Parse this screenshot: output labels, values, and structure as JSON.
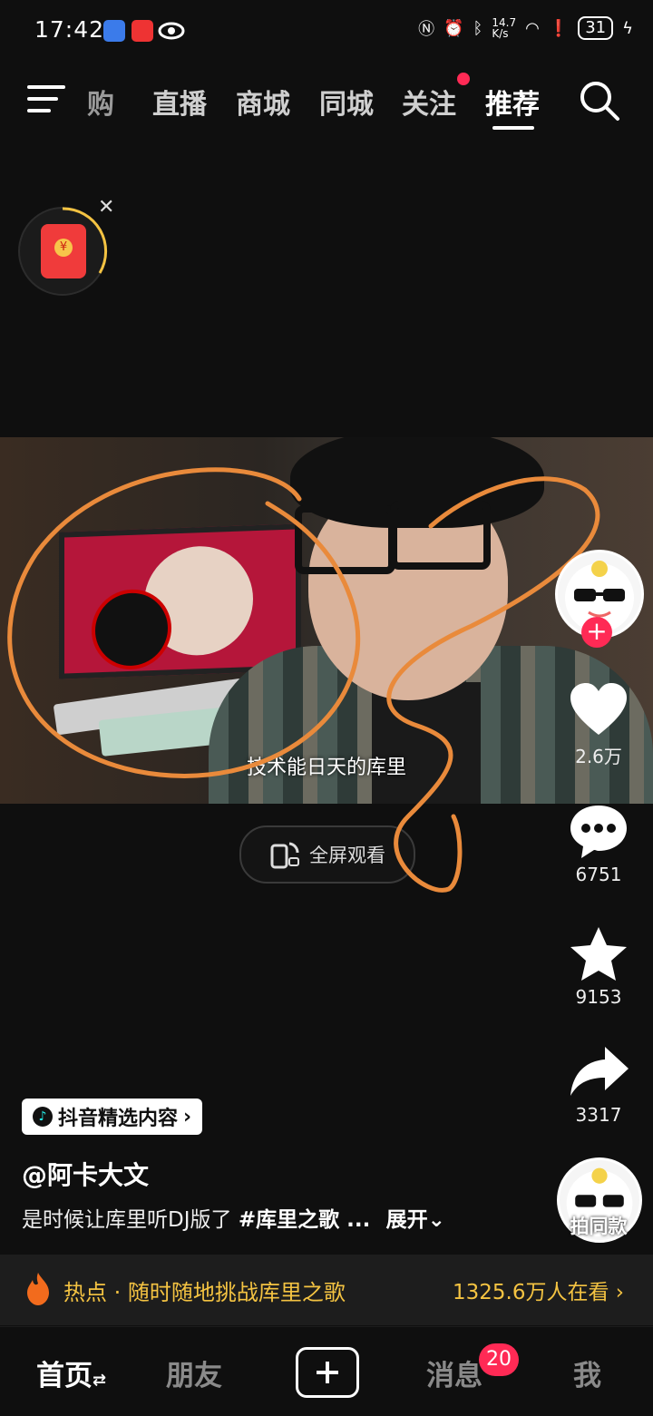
{
  "status_bar": {
    "time": "17:42",
    "net_speed": "14.7\nK/s",
    "battery": "31"
  },
  "top_tabs": {
    "items": [
      "购",
      "直播",
      "商城",
      "同城",
      "关注",
      "推荐"
    ],
    "active": "推荐"
  },
  "video": {
    "subtitle": "技术能日天的库里",
    "fullscreen_label": "全屏观看"
  },
  "actions": {
    "likes": "2.6万",
    "comments": "6751",
    "favorites": "9153",
    "shares": "3317"
  },
  "caption": {
    "tag": "抖音精选内容",
    "author": "@阿卡大文",
    "text": "是时候让库里听DJ版了",
    "hashtag": "#库里之歌 ...",
    "expand": "展开",
    "same_style": "拍同款"
  },
  "hotbar": {
    "label": "热点",
    "title": "随时随地挑战库里之歌",
    "viewers": "1325.6万人在看"
  },
  "bottom_nav": {
    "home": "首页",
    "friends": "朋友",
    "messages": "消息",
    "messages_badge": "20",
    "me": "我"
  },
  "colors": {
    "accent": "#ff2a55",
    "hot": "#f4c342",
    "annotation": "#e98a3b"
  }
}
